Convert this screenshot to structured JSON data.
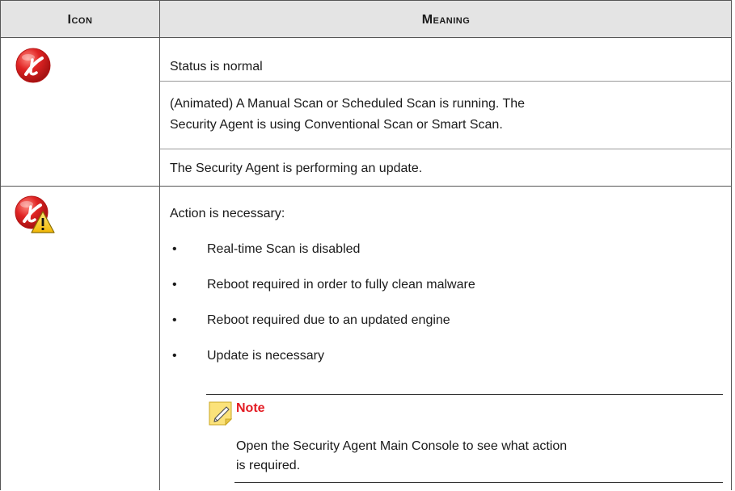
{
  "table": {
    "headers": {
      "icon": "Icon",
      "meaning": "Meaning"
    },
    "rows": [
      {
        "icon": "trend-micro-normal-icon",
        "meanings": [
          "Status is normal",
          [
            "(Animated) A Manual Scan or Scheduled Scan is running. The",
            "Security Agent is using Conventional Scan or Smart Scan."
          ],
          "The Security Agent is performing an update."
        ]
      },
      {
        "icon": "trend-micro-warning-icon",
        "intro": "Action is necessary:",
        "bullet_char": "•",
        "bullets": [
          "Real-time Scan is disabled",
          "Reboot required in order to fully clean malware",
          "Reboot required due to an updated engine",
          "Update is necessary"
        ],
        "note": {
          "title": "Note",
          "lines": [
            "Open the Security Agent Main Console to see what action",
            "is required."
          ]
        }
      }
    ]
  },
  "colors": {
    "header_bg": "#e4e4e4",
    "note_title": "#e31b23",
    "icon_red": "#d71920"
  }
}
